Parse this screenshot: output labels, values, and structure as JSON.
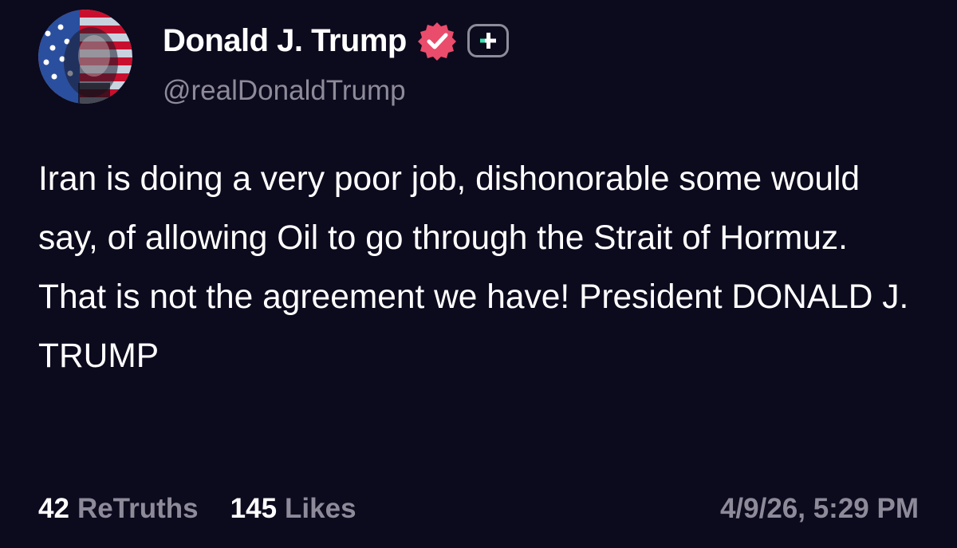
{
  "author": {
    "display_name": "Donald J. Trump",
    "handle": "@realDonaldTrump",
    "avatar_icon": "flag-portrait-avatar",
    "verified_icon": "verified-badge-icon",
    "plus_icon": "plus-icon"
  },
  "post": {
    "text": "Iran is doing a very poor job, dishonorable some would say, of allowing Oil to go through the Strait of Hormuz. That is not the agreement we have! President DONALD J. TRUMP"
  },
  "stats": {
    "retruths_count": "42",
    "retruths_label": "ReTruths",
    "likes_count": "145",
    "likes_label": "Likes",
    "timestamp": "4/9/26, 5:29 PM"
  },
  "colors": {
    "background": "#0c0a1d",
    "text": "#ffffff",
    "muted": "#8d8b99",
    "verified_badge": "#ea4c6b",
    "plus_accent": "#3fe3b4"
  }
}
